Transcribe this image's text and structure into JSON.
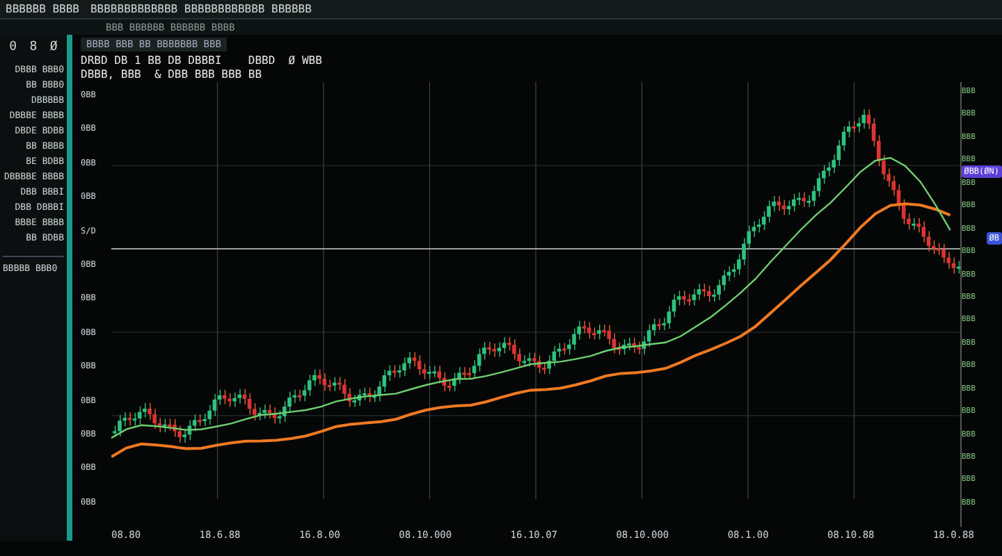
{
  "top_bar": {
    "title": "BBBBBB BBBB",
    "menu": "BBBBBBBBBBBBB BBBBBBBBBBBB BBBBBB",
    "submenu": "BBB BBBBBB BBBBBB BBBB"
  },
  "toolbar": {
    "icons": [
      "0",
      "8",
      "Ø"
    ],
    "tab": "BBBB BBB BB BBBBBBB BBB"
  },
  "sidebar": {
    "items": [
      {
        "label": "DBBB BBB0",
        "selected": false
      },
      {
        "label": "BB BBB0",
        "selected": false
      },
      {
        "label": "DBBBBB",
        "selected": false
      },
      {
        "label": "DBBBE BBBB",
        "selected": false
      },
      {
        "label": "DBDE BDBB",
        "selected": false
      },
      {
        "label": "BB BBBB",
        "selected": false
      },
      {
        "label": "BE BDBB",
        "selected": false
      },
      {
        "label": "DBBBBE BBBB",
        "selected": false
      },
      {
        "label": "DBB BBBI",
        "selected": false
      },
      {
        "label": "DBB DBBBI",
        "selected": false
      },
      {
        "label": "BBBE BBBB",
        "selected": false
      },
      {
        "label": "BB BDBB",
        "selected": false
      }
    ],
    "footer": "BBBBB BBB0"
  },
  "chart": {
    "header_lines": [
      "DRBD DB 1 BB DB DBBBI    DBBD  Ø WBB",
      "DBBB, BBB  & DBB BBB BBB BB"
    ],
    "y_labels": [
      "0BB",
      "0BB",
      "0BB",
      "0BB",
      "S/D",
      "0BB",
      "0BB",
      "0BB",
      "0BB",
      "0BB",
      "0BB",
      "0BB",
      "0BB"
    ],
    "x_labels": [
      "08.80",
      "18.6.88",
      "16.8.00",
      "08.10.000",
      "16.10.07",
      "08.10.000",
      "08.1.00",
      "08.10.88",
      "18.0.88"
    ],
    "price_badges": [
      {
        "label": "ØBB(ØN)",
        "color": "#5b3fd6"
      },
      {
        "label": "ØB",
        "color": "#3a55d8"
      }
    ],
    "right_labels": [
      "BBB",
      "BBB",
      "BBB",
      "BBB",
      "BBB",
      "BBB",
      "BBB",
      "BBB",
      "BBB",
      "BBB",
      "BBB",
      "BBB",
      "BBB",
      "BBB",
      "BBB",
      "BBB",
      "BBB",
      "BBB",
      "BBB"
    ]
  }
}
